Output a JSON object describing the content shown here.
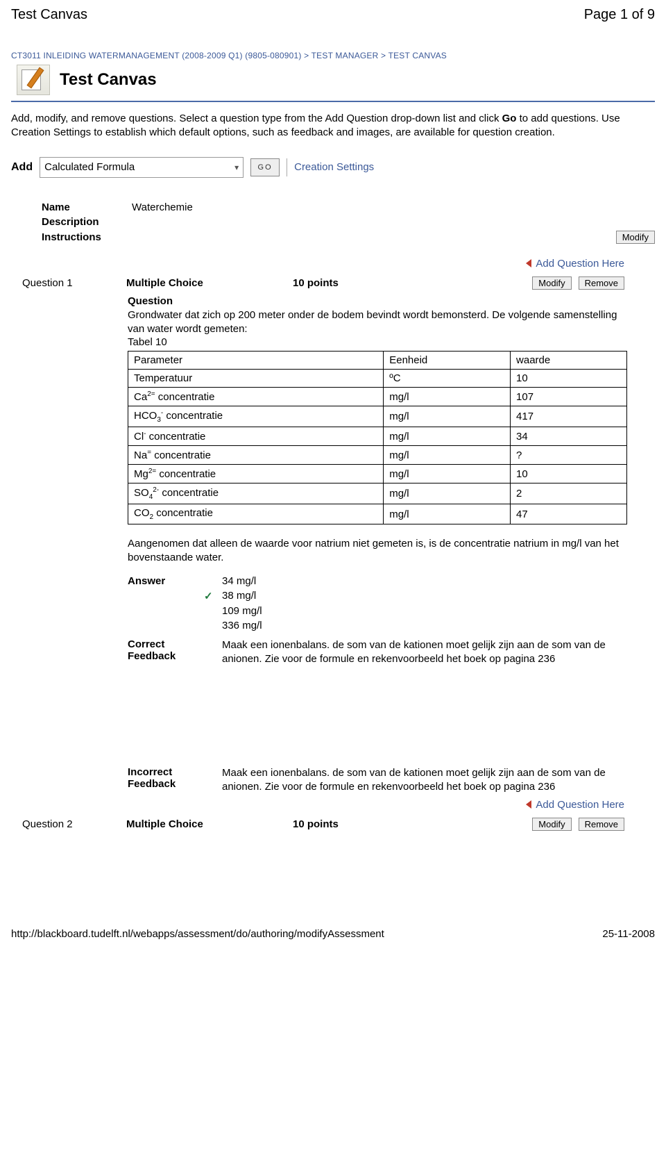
{
  "header": {
    "left": "Test Canvas",
    "right": "Page 1 of 9"
  },
  "breadcrumb": {
    "course": "CT3011 INLEIDING WATERMANAGEMENT (2008-2009 Q1) (9805-080901)",
    "sep": " > ",
    "manager": "TEST MANAGER",
    "canvas": "TEST CANVAS"
  },
  "title": "Test Canvas",
  "intro": "Add, modify, and remove questions. Select a question type from the Add Question drop-down list and click Go to add questions. Use Creation Settings to establish which default options, such as feedback and images, are available for question creation.",
  "toolbar": {
    "add_label": "Add",
    "select_value": "Calculated Formula",
    "go_label": "GO",
    "creation_settings": "Creation Settings"
  },
  "meta": {
    "name_label": "Name",
    "name_value": "Waterchemie",
    "description_label": "Description",
    "instructions_label": "Instructions",
    "modify_btn": "Modify"
  },
  "add_question_here": "Add Question Here",
  "q1": {
    "num": "Question 1",
    "type": "Multiple Choice",
    "points": "10 points",
    "modify_btn": "Modify",
    "remove_btn": "Remove",
    "question_label": "Question",
    "question_text_1": "Grondwater dat zich op 200 meter onder de bodem bevindt wordt bemonsterd. De volgende samenstelling van water wordt gemeten:",
    "table_caption": "Tabel 10",
    "table": {
      "headers": [
        "Parameter",
        "Eenheid",
        "waarde"
      ],
      "rows": [
        {
          "p": "Temperatuur",
          "u": "ºC",
          "v": "10"
        },
        {
          "p": "Ca2= concentratie",
          "p_html": "Ca<span class='sup'>2=</span> concentratie",
          "u": "mg/l",
          "v": "107"
        },
        {
          "p": "HCO3- concentratie",
          "p_html": "HCO<span class='sub'>3</span><span class='sup'>-</span> concentratie",
          "u": "mg/l",
          "v": "417"
        },
        {
          "p": "Cl- concentratie",
          "p_html": "Cl<span class='sup'>-</span> concentratie",
          "u": "mg/l",
          "v": "34"
        },
        {
          "p": "Na= concentratie",
          "p_html": "Na<span class='sup'>=</span> concentratie",
          "u": "mg/l",
          "v": "?"
        },
        {
          "p": "Mg2= concentratie",
          "p_html": "Mg<span class='sup'>2=</span> concentratie",
          "u": "mg/l",
          "v": "10"
        },
        {
          "p": "SO42- concentratie",
          "p_html": "SO<span class='sub'>4</span><span class='sup'>2-</span> concentratie",
          "u": "mg/l",
          "v": "2"
        },
        {
          "p": "CO2 concentratie",
          "p_html": "CO<span class='sub'>2</span> concentratie",
          "u": "mg/l",
          "v": "47"
        }
      ]
    },
    "after_table": "Aangenomen dat alleen de waarde voor natrium niet gemeten is, is de concentratie natrium in mg/l van het bovenstaande water.",
    "answer_label": "Answer",
    "answers": [
      {
        "text": "34 mg/l",
        "correct": false
      },
      {
        "text": "38 mg/l",
        "correct": true
      },
      {
        "text": "109 mg/l",
        "correct": false
      },
      {
        "text": "336 mg/l",
        "correct": false
      }
    ],
    "correct_fb_label": "Correct Feedback",
    "correct_fb": "Maak een ionenbalans. de som van de kationen moet gelijk zijn aan de som van de anionen. Zie voor de formule en rekenvoorbeeld het boek op pagina 236",
    "incorrect_fb_label": "Incorrect Feedback",
    "incorrect_fb": "Maak een ionenbalans. de som van de kationen moet gelijk zijn aan de som van de anionen. Zie voor de formule en rekenvoorbeeld het boek op pagina 236"
  },
  "q2": {
    "num": "Question 2",
    "type": "Multiple Choice",
    "points": "10 points",
    "modify_btn": "Modify",
    "remove_btn": "Remove"
  },
  "footer": {
    "url": "http://blackboard.tudelft.nl/webapps/assessment/do/authoring/modifyAssessment",
    "date": "25-11-2008"
  }
}
